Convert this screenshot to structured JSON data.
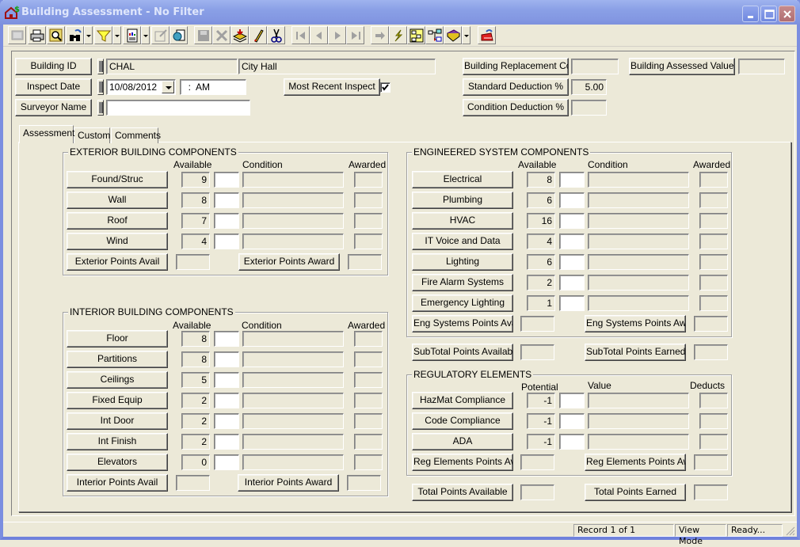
{
  "window": {
    "title": "Building Assessment - No Filter",
    "icon": "house-dollar-icon",
    "controls": [
      "minimize",
      "maximize",
      "close"
    ]
  },
  "toolbar": {
    "buttons": [
      {
        "name": "form-view-button",
        "icon": "form-grid-icon",
        "enabled": false
      },
      {
        "name": "print-button",
        "icon": "printer-icon",
        "enabled": true
      },
      {
        "name": "print-preview-button",
        "icon": "magnifier-page-icon",
        "enabled": true
      },
      {
        "name": "find-button",
        "icon": "binoculars-icon",
        "enabled": true,
        "dropdown": true
      },
      {
        "name": "filter-button",
        "icon": "funnel-icon",
        "enabled": true,
        "dropdown": true
      },
      {
        "name": "report-button",
        "icon": "report-icon",
        "enabled": true,
        "dropdown": true
      },
      {
        "name": "export-button",
        "icon": "export-doc-icon",
        "enabled": false
      },
      {
        "name": "copy-doc-button",
        "icon": "copy-doc-icon",
        "enabled": true
      },
      {
        "name": "save-button",
        "icon": "disk-icon",
        "enabled": false
      },
      {
        "name": "delete-button",
        "icon": "x-icon",
        "enabled": false
      },
      {
        "name": "add-record-button",
        "icon": "stack-add-icon",
        "enabled": true
      },
      {
        "name": "edit-button",
        "icon": "pencil-icon",
        "enabled": true
      },
      {
        "name": "cut-button",
        "icon": "scissors-icon",
        "enabled": true
      },
      {
        "name": "first-record-button",
        "icon": "first-icon",
        "enabled": false
      },
      {
        "name": "prev-record-button",
        "icon": "prev-icon",
        "enabled": false
      },
      {
        "name": "next-record-button",
        "icon": "next-icon",
        "enabled": false
      },
      {
        "name": "last-record-button",
        "icon": "last-icon",
        "enabled": false
      },
      {
        "name": "goto-button",
        "icon": "arrow-right-icon",
        "enabled": false
      },
      {
        "name": "execute-button",
        "icon": "lightning-icon",
        "enabled": true
      },
      {
        "name": "hierarchy-button",
        "icon": "hierarchy-icon",
        "enabled": true
      },
      {
        "name": "relations-button",
        "icon": "relations-icon",
        "enabled": true
      },
      {
        "name": "help-book-button",
        "icon": "book-icon",
        "enabled": true,
        "dropdown": true
      },
      {
        "name": "exit-button",
        "icon": "exit-icon",
        "enabled": true
      }
    ]
  },
  "header": {
    "building_id_label": "Building ID",
    "building_id": "CHAL",
    "building_name": "City Hall",
    "inspect_date_label": "Inspect Date",
    "inspect_date": "10/08/2012",
    "inspect_time": "  :  AM",
    "most_recent_label": "Most Recent Inspect",
    "most_recent_checked": true,
    "surveyor_label": "Surveyor Name",
    "surveyor_name": "",
    "replacement_cost_label": "Building Replacement Cost",
    "replacement_cost": "",
    "assessed_value_label": "Building Assessed Value",
    "assessed_value": "",
    "standard_deduction_label": "Standard Deduction %",
    "standard_deduction": "5.00",
    "condition_deduction_label": "Condition Deduction %",
    "condition_deduction": ""
  },
  "tabs": [
    {
      "label": "Assessment",
      "active": true
    },
    {
      "label": "Custom",
      "active": false
    },
    {
      "label": "Comments",
      "active": false
    }
  ],
  "exterior": {
    "title": "EXTERIOR BUILDING COMPONENTS",
    "col_available": "Available",
    "col_condition": "Condition",
    "col_awarded": "Awarded",
    "rows": [
      {
        "label": "Found/Struc",
        "available": "9",
        "code": "",
        "condition": "",
        "awarded": ""
      },
      {
        "label": "Wall",
        "available": "8",
        "code": "",
        "condition": "",
        "awarded": ""
      },
      {
        "label": "Roof",
        "available": "7",
        "code": "",
        "condition": "",
        "awarded": ""
      },
      {
        "label": "Wind",
        "available": "4",
        "code": "",
        "condition": "",
        "awarded": ""
      }
    ],
    "avail_label": "Exterior Points Avail",
    "avail_value": "",
    "award_label": "Exterior Points Award",
    "award_value": ""
  },
  "interior": {
    "title": "INTERIOR BUILDING COMPONENTS",
    "col_available": "Available",
    "col_condition": "Condition",
    "col_awarded": "Awarded",
    "rows": [
      {
        "label": "Floor",
        "available": "8",
        "code": "",
        "condition": "",
        "awarded": ""
      },
      {
        "label": "Partitions",
        "available": "8",
        "code": "",
        "condition": "",
        "awarded": ""
      },
      {
        "label": "Ceilings",
        "available": "5",
        "code": "",
        "condition": "",
        "awarded": ""
      },
      {
        "label": "Fixed Equip",
        "available": "2",
        "code": "",
        "condition": "",
        "awarded": ""
      },
      {
        "label": "Int Door",
        "available": "2",
        "code": "",
        "condition": "",
        "awarded": ""
      },
      {
        "label": "Int Finish",
        "available": "2",
        "code": "",
        "condition": "",
        "awarded": ""
      },
      {
        "label": "Elevators",
        "available": "0",
        "code": "",
        "condition": "",
        "awarded": ""
      }
    ],
    "avail_label": "Interior Points Avail",
    "avail_value": "",
    "award_label": "Interior Points Award",
    "award_value": ""
  },
  "engineered": {
    "title": "ENGINEERED SYSTEM COMPONENTS",
    "col_available": "Available",
    "col_condition": "Condition",
    "col_awarded": "Awarded",
    "rows": [
      {
        "label": "Electrical",
        "available": "8",
        "code": "",
        "condition": "",
        "awarded": ""
      },
      {
        "label": "Plumbing",
        "available": "6",
        "code": "",
        "condition": "",
        "awarded": ""
      },
      {
        "label": "HVAC",
        "available": "16",
        "code": "",
        "condition": "",
        "awarded": ""
      },
      {
        "label": "IT Voice and Data",
        "available": "4",
        "code": "",
        "condition": "",
        "awarded": ""
      },
      {
        "label": "Lighting",
        "available": "6",
        "code": "",
        "condition": "",
        "awarded": ""
      },
      {
        "label": "Fire Alarm Systems",
        "available": "2",
        "code": "",
        "condition": "",
        "awarded": ""
      },
      {
        "label": "Emergency Lighting",
        "available": "1",
        "code": "",
        "condition": "",
        "awarded": ""
      }
    ],
    "avail_label": "Eng Systems Points Avail",
    "avail_value": "",
    "award_label": "Eng Systems Points Award",
    "award_value": ""
  },
  "subtotal": {
    "available_label": "SubTotal Points Available",
    "available_value": "",
    "earned_label": "SubTotal Points Earned",
    "earned_value": ""
  },
  "regulatory": {
    "title": "REGULATORY ELEMENTS",
    "col_potential": "Potential",
    "col_value": "Value",
    "col_deducts": "Deducts",
    "rows": [
      {
        "label": "HazMat Compliance",
        "potential": "-1",
        "code": "",
        "value": "",
        "deducts": ""
      },
      {
        "label": "Code Compliance",
        "potential": "-1",
        "code": "",
        "value": "",
        "deducts": ""
      },
      {
        "label": "ADA",
        "potential": "-1",
        "code": "",
        "value": "",
        "deducts": ""
      }
    ],
    "avail_label": "Reg Elements Points Avail",
    "avail_value": "",
    "award_label": "Reg Elements Points Award",
    "award_value": ""
  },
  "total": {
    "available_label": "Total Points Available",
    "available_value": "",
    "earned_label": "Total Points Earned",
    "earned_value": ""
  },
  "status": {
    "record": "Record 1 of 1",
    "mode": "View Mode",
    "state": "Ready..."
  }
}
